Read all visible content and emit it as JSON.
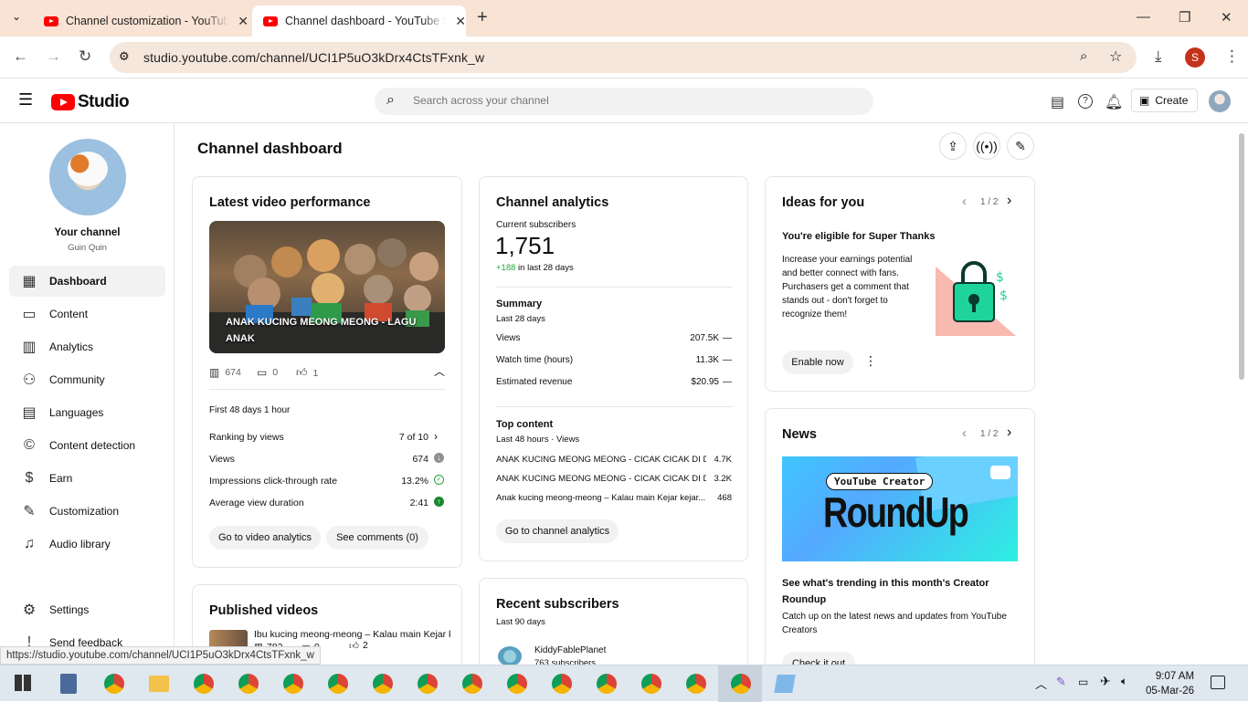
{
  "browser": {
    "tabs": [
      {
        "title": "Channel customization - YouTube Studio",
        "active": false
      },
      {
        "title": "Channel dashboard - YouTube Studio",
        "active": true
      }
    ],
    "new_tab": "+",
    "url": "studio.youtube.com/channel/UCI1P5uO3kDrx4CtsTFxnk_w",
    "profile_initial": "S",
    "status_url": "https://studio.youtube.com/channel/UCI1P5uO3kDrx4CtsTFxnk_w"
  },
  "studio": {
    "logo_text": "Studio",
    "search_placeholder": "Search across your channel",
    "create_label": "Create"
  },
  "sidebar": {
    "channel_label": "Your channel",
    "channel_name": "Guin Quin",
    "items": [
      {
        "label": "Dashboard",
        "icon": "grid-icon"
      },
      {
        "label": "Content",
        "icon": "content-icon"
      },
      {
        "label": "Analytics",
        "icon": "analytics-icon"
      },
      {
        "label": "Community",
        "icon": "community-icon"
      },
      {
        "label": "Languages",
        "icon": "subtitles-icon"
      },
      {
        "label": "Content detection",
        "icon": "copyright-icon"
      },
      {
        "label": "Earn",
        "icon": "dollar-icon"
      },
      {
        "label": "Customization",
        "icon": "magic-icon"
      },
      {
        "label": "Audio library",
        "icon": "audio-icon"
      }
    ],
    "settings": "Settings",
    "feedback": "Send feedback"
  },
  "page": {
    "title": "Channel dashboard"
  },
  "latest": {
    "title": "Latest video performance",
    "video_title": "ANAK KUCING MEONG MEONG - LAGU ANAK",
    "views": "674",
    "comments": "0",
    "likes": "1",
    "period": "First 48 days 1 hour",
    "stats": [
      {
        "label": "Ranking by views",
        "value": "7 of 10"
      },
      {
        "label": "Views",
        "value": "674"
      },
      {
        "label": "Impressions click-through rate",
        "value": "13.2%"
      },
      {
        "label": "Average view duration",
        "value": "2:41"
      }
    ],
    "btn_analytics": "Go to video analytics",
    "btn_comments": "See comments (0)"
  },
  "published": {
    "title": "Published videos",
    "item_title": "Ibu kucing meong-meong – Kalau main Kejar k...",
    "item_views": "782",
    "item_comments": "0",
    "item_likes": "2"
  },
  "analytics": {
    "title": "Channel analytics",
    "subs_label": "Current subscribers",
    "subs_value": "1,751",
    "subs_change": "+188",
    "subs_change_suffix": "in last 28 days",
    "summary_title": "Summary",
    "summary_period": "Last 28 days",
    "summary": [
      {
        "label": "Views",
        "value": "207.5K",
        "trend": "—"
      },
      {
        "label": "Watch time (hours)",
        "value": "11.3K",
        "trend": "—"
      },
      {
        "label": "Estimated revenue",
        "value": "$20.95",
        "trend": "—"
      }
    ],
    "top_title": "Top content",
    "top_period": "Last 48 hours · Views",
    "top": [
      {
        "title": "ANAK KUCING MEONG MEONG - CICAK CICAK DI D...",
        "views": "4.7K"
      },
      {
        "title": "ANAK KUCING MEONG MEONG - CICAK CICAK DI D...",
        "views": "3.2K"
      },
      {
        "title": "Anak kucing meong-meong – Kalau main Kejar kejar...",
        "views": "468"
      }
    ],
    "btn": "Go to channel analytics"
  },
  "recent": {
    "title": "Recent subscribers",
    "period": "Last 90 days",
    "sub_name": "KiddyFablePlanet",
    "sub_count": "763 subscribers"
  },
  "ideas": {
    "title": "Ideas for you",
    "pager": "1 / 2",
    "heading": "You're eligible for Super Thanks",
    "body": "Increase your earnings potential and better connect with fans. Purchasers get a comment that stands out - don't forget to recognize them!",
    "btn": "Enable now"
  },
  "news": {
    "title": "News",
    "pager": "1 / 2",
    "banner_tag": "YouTube Creator",
    "banner_title": "RoundUp",
    "heading": "See what's trending in this month's Creator Roundup",
    "body": "Catch up on the latest news and updates from YouTube Creators",
    "btn": "Check it out"
  },
  "taskbar": {
    "time": "9:07 AM",
    "date": "05-Mar-26"
  }
}
